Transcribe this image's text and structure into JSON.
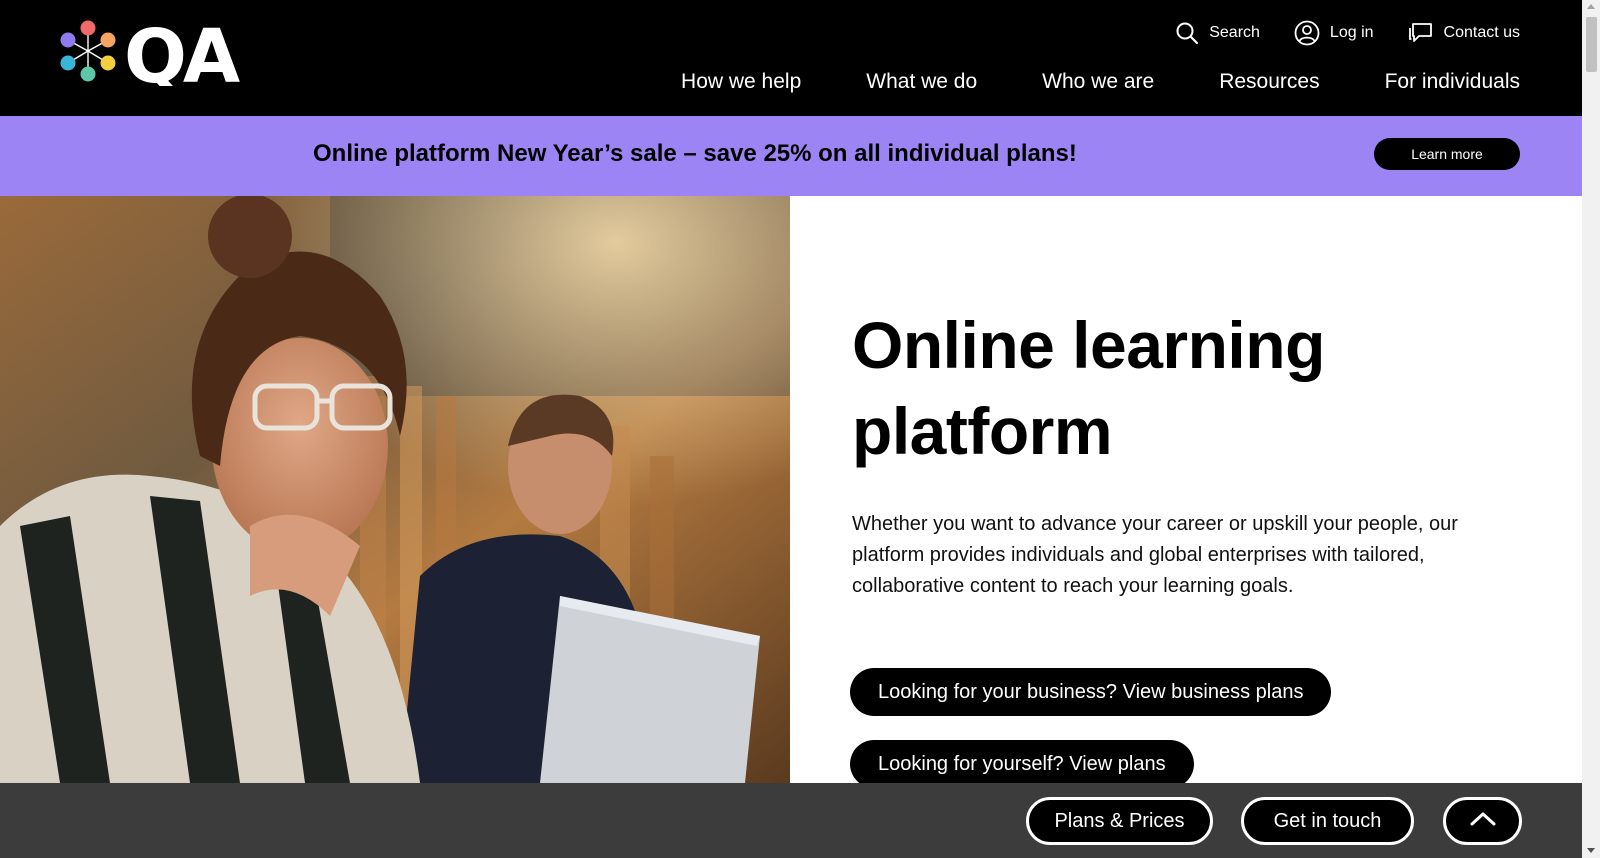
{
  "header": {
    "logo_text": "QA",
    "utility": [
      {
        "label": "Search",
        "icon": "search-icon"
      },
      {
        "label": "Log in",
        "icon": "user-icon"
      },
      {
        "label": "Contact us",
        "icon": "chat-icon"
      }
    ],
    "nav": [
      "How we help",
      "What we do",
      "Who we are",
      "Resources",
      "For individuals"
    ]
  },
  "banner": {
    "text": "Online platform New Year’s sale – save 25% on all individual plans!",
    "button": "Learn more",
    "color": "#9d84f5"
  },
  "hero": {
    "title_line1": "Online learning",
    "title_line2": "platform",
    "description": "Whether you want to advance your career or upskill your people, our platform provides individuals and global enterprises with tailored, collaborative content to reach your learning goals.",
    "cta_business": "Looking for your business? View business plans",
    "cta_personal": "Looking for yourself? View plans",
    "image": "photo-woman-studying-at-laptop"
  },
  "bottom_bar": {
    "plans": "Plans & Prices",
    "contact": "Get in touch",
    "up_icon": "chevron-up-icon"
  }
}
